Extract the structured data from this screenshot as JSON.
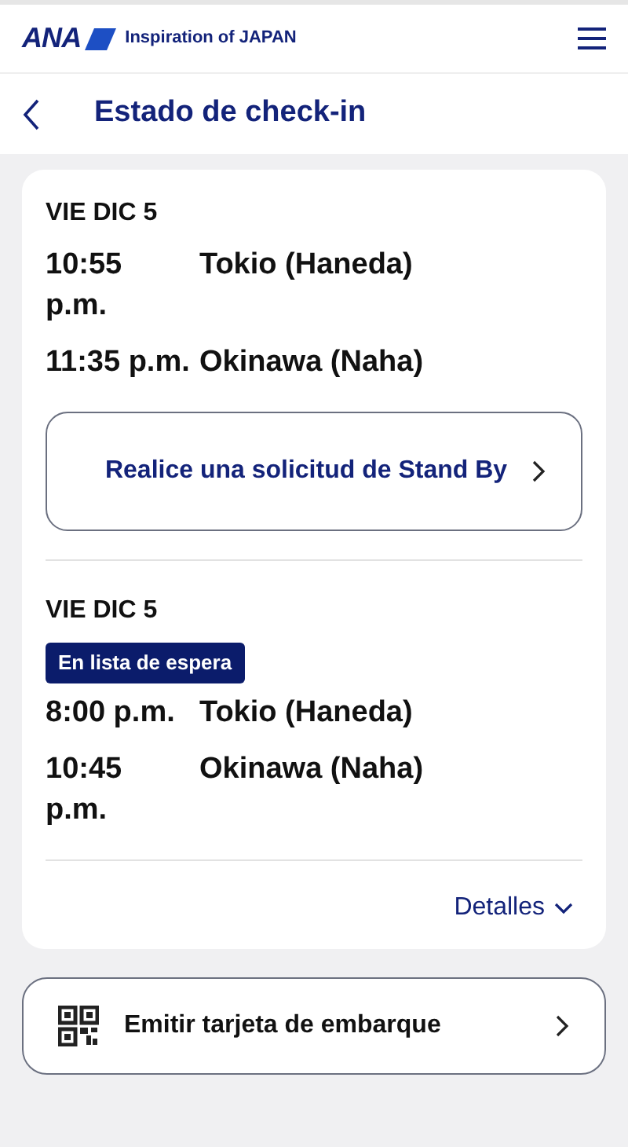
{
  "header": {
    "logo": "ANA",
    "tagline": "Inspiration of JAPAN"
  },
  "page_title": "Estado de check-in",
  "flights": [
    {
      "date": "VIE DIC 5",
      "segments": [
        {
          "time": "10:55 p.m.",
          "place": "Tokio (Haneda)"
        },
        {
          "time": "11:35 p.m.",
          "place": "Okinawa (Naha)"
        }
      ],
      "action": "Realice una solicitud de Stand By"
    },
    {
      "date": "VIE DIC 5",
      "badge": "En lista de espera",
      "segments": [
        {
          "time": "8:00 p.m.",
          "place": "Tokio (Haneda)"
        },
        {
          "time": "10:45 p.m.",
          "place": "Okinawa (Naha)"
        }
      ]
    }
  ],
  "details_link": "Detalles",
  "boarding_pass_button": "Emitir tarjeta de embarque"
}
